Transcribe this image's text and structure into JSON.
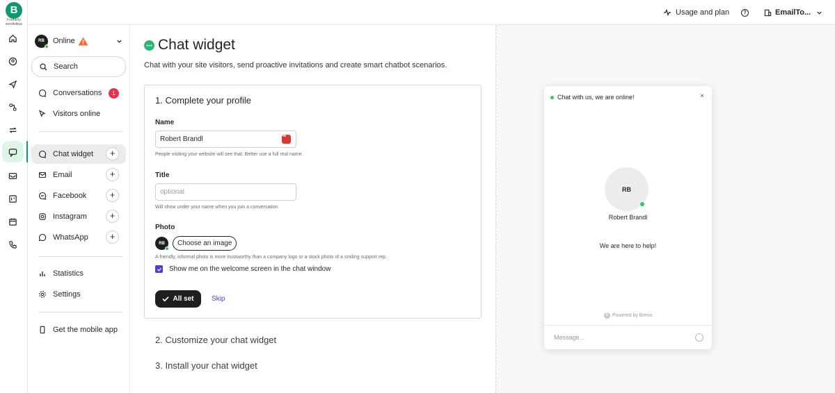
{
  "brand": {
    "logo_letter": "B",
    "logo_sub": "Formerly sendinblue",
    "accent": "#0b996e"
  },
  "rail": {
    "icons": [
      "home-icon",
      "contacts-icon",
      "campaigns-icon",
      "automations-icon",
      "transactional-icon",
      "conversations-icon",
      "inbox-icon",
      "crm-icon",
      "meetings-icon",
      "phone-icon"
    ]
  },
  "topbar": {
    "usage_label": "Usage and plan",
    "account_label": "EmailTo..."
  },
  "sidebar": {
    "avatar_initials": "RB",
    "status_label": "Online",
    "search_label": "Search",
    "conversations_label": "Conversations",
    "conversations_badge": "1",
    "visitors_label": "Visitors online",
    "channels": [
      {
        "label": "Chat widget",
        "icon": "chat-icon"
      },
      {
        "label": "Email",
        "icon": "mail-icon"
      },
      {
        "label": "Facebook",
        "icon": "facebook-icon"
      },
      {
        "label": "Instagram",
        "icon": "instagram-icon"
      },
      {
        "label": "WhatsApp",
        "icon": "whatsapp-icon"
      }
    ],
    "statistics_label": "Statistics",
    "settings_label": "Settings",
    "mobile_label": "Get the mobile app"
  },
  "main": {
    "title": "Chat widget",
    "subtitle": "Chat with your site visitors, send proactive invitations and create smart chatbot scenarios.",
    "step1": {
      "title": "1. Complete your profile",
      "name_label": "Name",
      "name_value": "Robert Brandl",
      "name_hint": "People visiting your website will see that. Better use a full real name.",
      "title_label": "Title",
      "title_placeholder": "optional",
      "title_hint": "Will show under your name when you join a conversation",
      "photo_label": "Photo",
      "photo_initials": "RB",
      "choose_image": "Choose an image",
      "photo_hint": "A friendly, informal photo is more trustworthy than a company logo or a stock photo of a smiling support rep.",
      "show_me_label": "Show me on the welcome screen in the chat window",
      "show_me_checked": true,
      "all_set": "All set",
      "skip": "Skip"
    },
    "step2_title": "2. Customize your chat widget",
    "step3_title": "3. Install your chat widget"
  },
  "widget": {
    "header": "Chat with us, we are online!",
    "close": "×",
    "avatar_initials": "RB",
    "agent_name": "Robert Brandl",
    "help_text": "We are here to help!",
    "powered_by": "Powered by Brevo",
    "message_placeholder": "Message..."
  }
}
